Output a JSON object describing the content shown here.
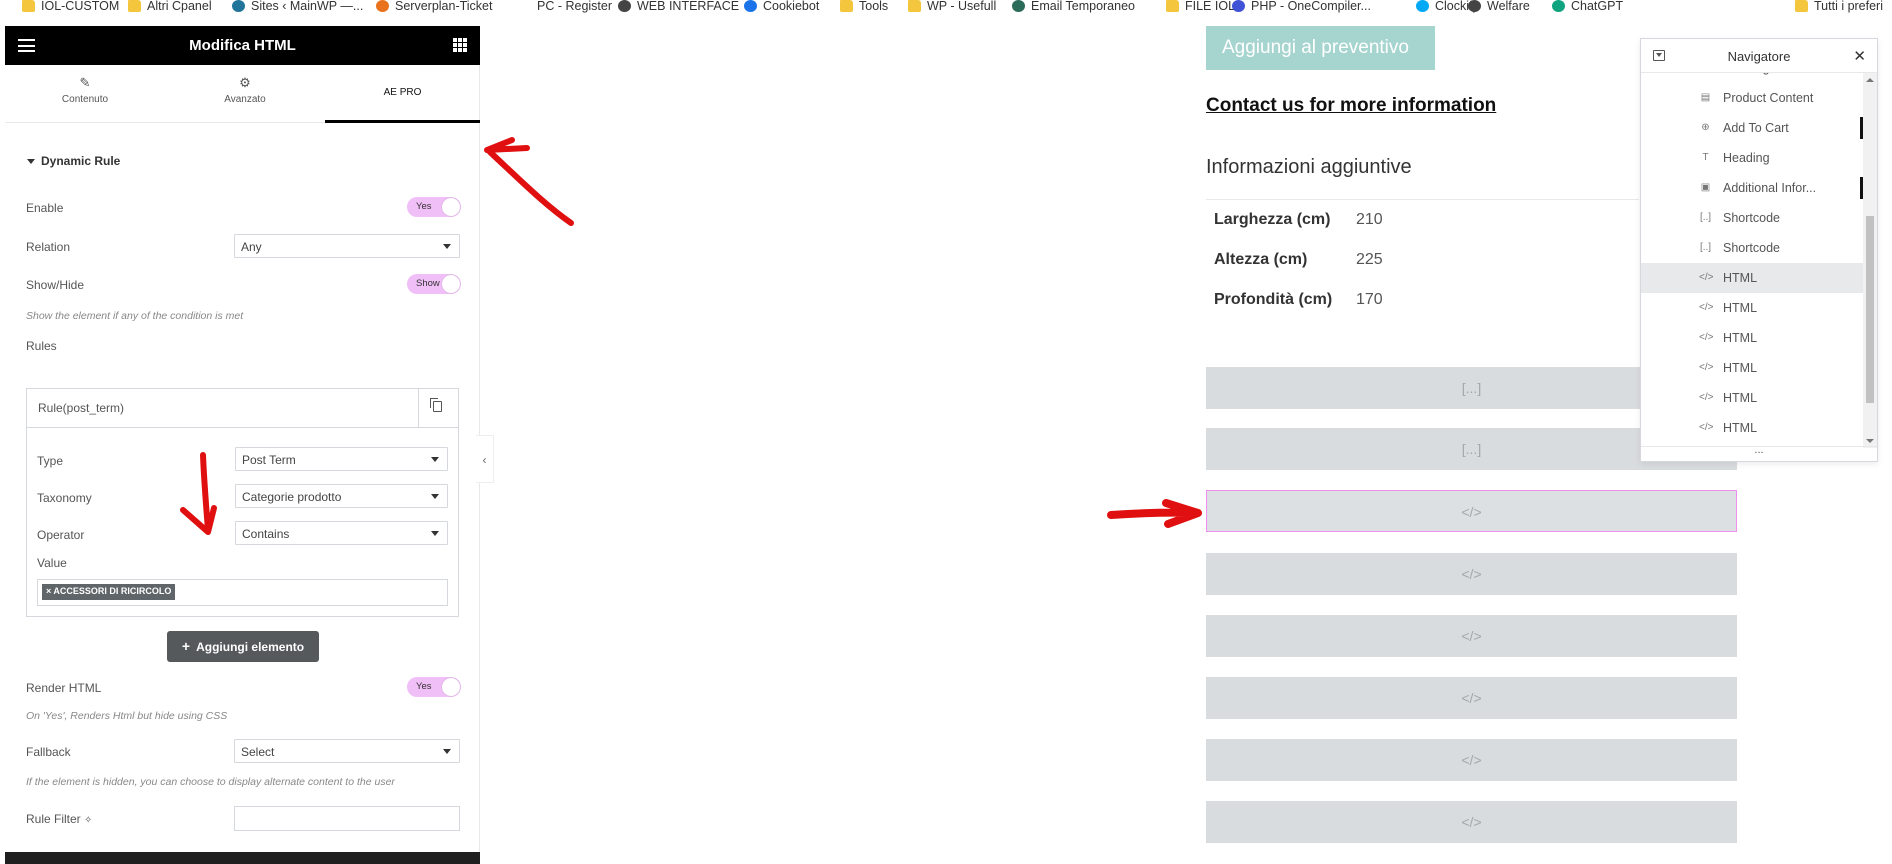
{
  "bookmarks": [
    {
      "label": "IOL-CUSTOM",
      "icon": "folder-icon"
    },
    {
      "label": "Altri Cpanel",
      "icon": "folder-icon"
    },
    {
      "label": "Sites ‹ MainWP —...",
      "icon": "wordpress-icon"
    },
    {
      "label": "Serverplan-Ticket",
      "icon": "serverplan-icon"
    },
    {
      "label": "PC - Register",
      "icon": "blank-page-icon"
    },
    {
      "label": "WEB INTERFACE",
      "icon": "globe-icon"
    },
    {
      "label": "Cookiebot",
      "icon": "cookiebot-icon"
    },
    {
      "label": "Tools",
      "icon": "folder-icon"
    },
    {
      "label": "WP - Usefull",
      "icon": "folder-icon"
    },
    {
      "label": "Email Temporaneo",
      "icon": "email-temp-icon"
    },
    {
      "label": "FILE IOL",
      "icon": "folder-icon"
    },
    {
      "label": "PHP - OneCompiler...",
      "icon": "onecompiler-icon"
    },
    {
      "label": "Clockify",
      "icon": "clockify-icon"
    },
    {
      "label": "Welfare",
      "icon": "globe-icon"
    },
    {
      "label": "ChatGPT",
      "icon": "chatgpt-icon"
    },
    {
      "label": "Tutti i preferi",
      "icon": "folder-icon"
    }
  ],
  "panel": {
    "title": "Modifica HTML",
    "tabs": [
      {
        "label": "Contenuto",
        "icon": "pencil-icon"
      },
      {
        "label": "Avanzato",
        "icon": "gear-icon"
      },
      {
        "label": "AE PRO",
        "icon": ""
      }
    ],
    "section_title": "Dynamic Rule",
    "enable": {
      "label": "Enable",
      "toggle": "Yes"
    },
    "relation": {
      "label": "Relation",
      "value": "Any"
    },
    "show_hide": {
      "label": "Show/Hide",
      "toggle": "Show",
      "help": "Show the element if any of the condition is met"
    },
    "rules_label": "Rules",
    "rule": {
      "name": "Rule(post_term)",
      "type": {
        "label": "Type",
        "value": "Post Term"
      },
      "taxonomy": {
        "label": "Taxonomy",
        "value": "Categorie prodotto"
      },
      "operator": {
        "label": "Operator",
        "value": "Contains"
      },
      "value_label": "Value",
      "value_tag": "× ACCESSORI DI RICIRCOLO"
    },
    "add_button": "Aggiungi elemento",
    "render_html": {
      "label": "Render HTML",
      "toggle": "Yes",
      "help": "On 'Yes', Renders Html but hide using CSS"
    },
    "fallback": {
      "label": "Fallback",
      "value": "Select",
      "help": "If the element is hidden, you can choose to display alternate content to the user"
    },
    "rule_filter": {
      "label": "Rule Filter",
      "value": ""
    }
  },
  "preview": {
    "quote_button": "Aggiungi al preventivo",
    "contact_link": "Contact us for more information",
    "info_title": "Informazioni aggiuntive",
    "attributes": [
      {
        "label": "Larghezza (cm)",
        "value": "210"
      },
      {
        "label": "Altezza (cm)",
        "value": "225"
      },
      {
        "label": "Profondità (cm)",
        "value": "170"
      }
    ],
    "placeholders": [
      "[...]",
      "[...]",
      "</>",
      "</>",
      "</>",
      "</>",
      "</>",
      "</>"
    ]
  },
  "navigator": {
    "title": "Navigatore",
    "items": [
      {
        "label": "Heading",
        "icon": "heading-icon"
      },
      {
        "label": "Product Content",
        "icon": "product-content-icon"
      },
      {
        "label": "Add To Cart",
        "icon": "add-to-cart-icon"
      },
      {
        "label": "Heading",
        "icon": "heading-icon"
      },
      {
        "label": "Additional Infor...",
        "icon": "additional-info-icon"
      },
      {
        "label": "Shortcode",
        "icon": "shortcode-icon"
      },
      {
        "label": "Shortcode",
        "icon": "shortcode-icon"
      },
      {
        "label": "HTML",
        "icon": "code-icon"
      },
      {
        "label": "HTML",
        "icon": "code-icon"
      },
      {
        "label": "HTML",
        "icon": "code-icon"
      },
      {
        "label": "HTML",
        "icon": "code-icon"
      },
      {
        "label": "HTML",
        "icon": "code-icon"
      },
      {
        "label": "HTML",
        "icon": "code-icon"
      }
    ],
    "footer": "..."
  },
  "colors": {
    "toggle_on": "#f0bff7",
    "accent_selected": "#f08ff0",
    "annotation": "#e01010",
    "quote_button": "#a6d4cf"
  }
}
